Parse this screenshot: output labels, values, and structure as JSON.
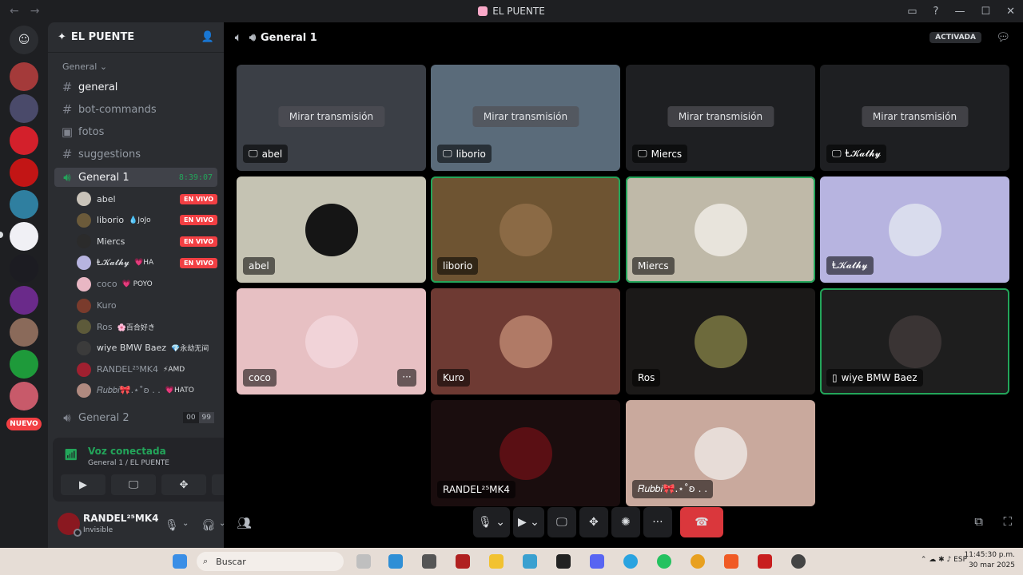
{
  "window": {
    "title": "EL PUENTE",
    "back": "←",
    "forward": "→"
  },
  "rail": {
    "new_badge": "NUEVO"
  },
  "server": {
    "name": "EL PUENTE"
  },
  "sidebar": {
    "category": "General",
    "channels": [
      {
        "sym": "#",
        "label": "general"
      },
      {
        "sym": "#",
        "label": "bot-commands"
      },
      {
        "sym": "▣",
        "label": "fotos"
      },
      {
        "sym": "#",
        "label": "suggestions"
      }
    ],
    "voice1": {
      "label": "General 1",
      "timer": "8:39:07"
    },
    "voice_users": [
      {
        "name": "abel",
        "tag": "",
        "live": "EN VIVO",
        "color": "#c9c3b9"
      },
      {
        "name": "liborio",
        "tag": "💧JoJo",
        "live": "EN VIVO",
        "color": "#6b5a3a"
      },
      {
        "name": "Miercs",
        "tag": "",
        "live": "EN VIVO",
        "color": "#2b2b2b"
      },
      {
        "name": "Ⱡ𝓚𝓪𝓽𝓱𝔂",
        "tag": "💗HA",
        "live": "EN VIVO",
        "color": "#b7b4e0"
      },
      {
        "name": "coco",
        "tag": "💗 POYO",
        "live": "",
        "color": "#e9b7c4"
      },
      {
        "name": "Kuro",
        "tag": "",
        "live": "",
        "color": "#7a3b2c"
      },
      {
        "name": "Ros",
        "tag": "🌸百合好き",
        "live": "",
        "color": "#5d5a3a"
      },
      {
        "name": "wiye BMW Baez",
        "tag": "💎永劫无间",
        "live": "",
        "color": "#3b3b3b"
      },
      {
        "name": "RANDEL²⁵MK4",
        "tag": "⚡AMD",
        "live": "",
        "color": "#a02030"
      },
      {
        "name": "𝑅𝑢𝑏𝑏𝑖🎀.⋆˚ʚ . .",
        "tag": "💗HATO",
        "live": "",
        "color": "#b08a80"
      }
    ],
    "voice2": {
      "label": "General 2",
      "count_a": "00",
      "count_b": "99"
    }
  },
  "voice_panel": {
    "status": "Voz conectada",
    "location": "General 1 / EL PUENTE"
  },
  "user_panel": {
    "name": "RANDEL²⁵MK4",
    "status": "Invisible"
  },
  "call": {
    "channel": "General 1",
    "activity": "ACTIVADA",
    "watch_label": "Mirar transmisión",
    "streams": [
      {
        "name": "abel",
        "bg": "#3b3f46"
      },
      {
        "name": "liborio",
        "bg": "#5a6b7a"
      },
      {
        "name": "Miercs",
        "bg": "#1e1f22"
      },
      {
        "name": "Ⱡ𝓚𝓪𝓽𝓱𝔂",
        "bg": "#1e1f22"
      }
    ],
    "tiles": [
      {
        "name": "abel",
        "bg": "#c5c3b3",
        "av": "#151515",
        "speaking": false
      },
      {
        "name": "liborio",
        "bg": "#6e5432",
        "av": "#8b6a45",
        "speaking": true
      },
      {
        "name": "Miercs",
        "bg": "#bfb9a8",
        "av": "#e8e4dc",
        "speaking": true
      },
      {
        "name": "Ⱡ𝓚𝓪𝓽𝓱𝔂",
        "bg": "#b7b4e0",
        "av": "#d9dced",
        "speaking": false
      },
      {
        "name": "coco",
        "bg": "#e7c0c3",
        "av": "#f1d3d8",
        "speaking": false
      },
      {
        "name": "Kuro",
        "bg": "#6e3a33",
        "av": "#b07a66",
        "speaking": false
      },
      {
        "name": "Ros",
        "bg": "#1b1918",
        "av": "#6d6a3c",
        "speaking": false
      },
      {
        "name": "wiye BMW Baez",
        "bg": "#1e1e1e",
        "av": "#3a3434",
        "speaking": true
      },
      {
        "name": "RANDEL²⁵MK4",
        "bg": "#1a0d0e",
        "av": "#5a0f14",
        "speaking": false
      },
      {
        "name": "𝑅𝑢𝑏𝑏𝑖🎀.⋆˚ʚ . .",
        "bg": "#c9a99d",
        "av": "#e7dcd7",
        "speaking": false
      }
    ],
    "more_label": "···"
  },
  "taskbar": {
    "search": "Buscar",
    "lang": "ESP",
    "time": "11:45:30 p.m.",
    "date": "30 mar 2025"
  }
}
